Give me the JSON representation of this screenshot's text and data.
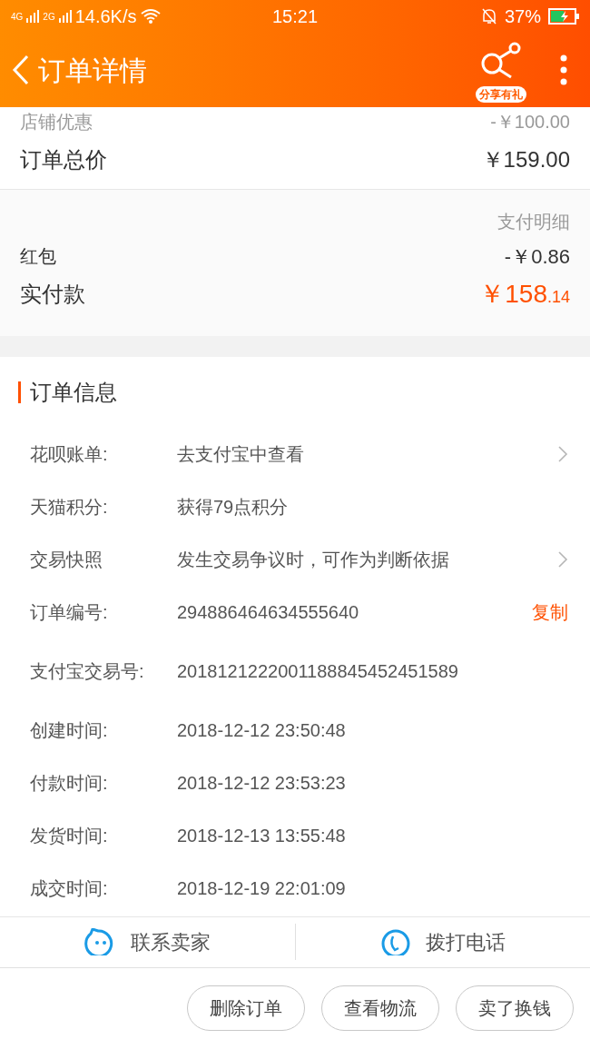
{
  "status_bar": {
    "network_1": "4G",
    "network_2": "2G",
    "speed": "14.6K/s",
    "time": "15:21",
    "battery": "37%"
  },
  "header": {
    "title": "订单详情",
    "share_badge": "分享有礼"
  },
  "summary": [
    {
      "label": "店铺优惠",
      "value": "-￥100.00",
      "kind": "discount"
    },
    {
      "label": "订单总价",
      "value": "￥159.00",
      "kind": "total"
    }
  ],
  "payment": {
    "title": "支付明细",
    "rows": [
      {
        "label": "红包",
        "value": "-￥0.86",
        "kind": "plain"
      },
      {
        "label": "实付款",
        "value": "￥158",
        "decimals": ".14",
        "kind": "paid"
      }
    ]
  },
  "order_info": {
    "title": "订单信息",
    "rows": [
      {
        "label": "花呗账单:",
        "value": "去支付宝中查看",
        "kind": "link"
      },
      {
        "label": "天猫积分:",
        "value": "获得79点积分",
        "kind": "plain"
      },
      {
        "label": "交易快照",
        "value": "发生交易争议时，可作为判断依据",
        "kind": "link"
      },
      {
        "label": "订单编号:",
        "value": "294886464634555640",
        "kind": "copy",
        "action": "复制"
      },
      {
        "label": "支付宝交易号:",
        "value": "2018121222001188845452451589",
        "kind": "plain"
      },
      {
        "label": "创建时间:",
        "value": "2018-12-12 23:50:48",
        "kind": "plain"
      },
      {
        "label": "付款时间:",
        "value": "2018-12-12 23:53:23",
        "kind": "plain"
      },
      {
        "label": "发货时间:",
        "value": "2018-12-13 13:55:48",
        "kind": "plain"
      },
      {
        "label": "成交时间:",
        "value": "2018-12-19 22:01:09",
        "kind": "plain"
      }
    ]
  },
  "contact": [
    {
      "label": "联系卖家",
      "kind": "chat"
    },
    {
      "label": "拨打电话",
      "kind": "phone"
    }
  ],
  "actions": [
    "删除订单",
    "查看物流",
    "卖了换钱"
  ]
}
